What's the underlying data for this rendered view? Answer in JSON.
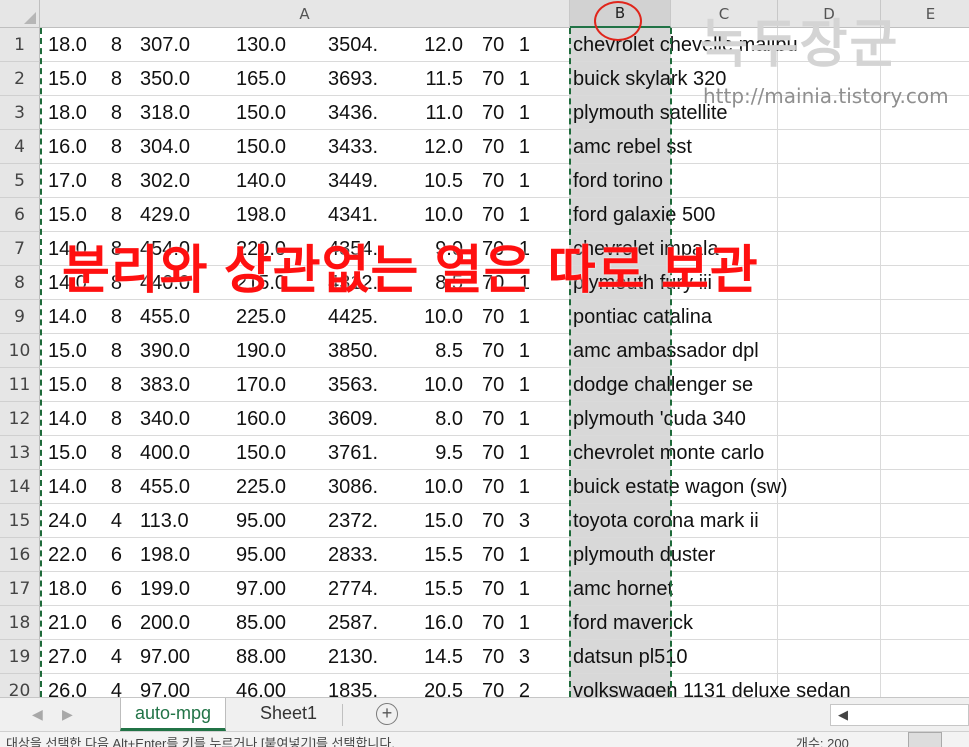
{
  "columns": {
    "A": "A",
    "B": "B",
    "C": "C",
    "D": "D",
    "E": "E"
  },
  "rows": [
    {
      "n": "1",
      "mpg": "18.0",
      "cyl": "8",
      "disp": "307.0",
      "hp": "130.0",
      "wt": "3504.",
      "acc": "12.0",
      "yr": "70",
      "org": "1",
      "name": "chevrolet chevelle malibu"
    },
    {
      "n": "2",
      "mpg": "15.0",
      "cyl": "8",
      "disp": "350.0",
      "hp": "165.0",
      "wt": "3693.",
      "acc": "11.5",
      "yr": "70",
      "org": "1",
      "name": "buick skylark 320"
    },
    {
      "n": "3",
      "mpg": "18.0",
      "cyl": "8",
      "disp": "318.0",
      "hp": "150.0",
      "wt": "3436.",
      "acc": "11.0",
      "yr": "70",
      "org": "1",
      "name": "plymouth satellite"
    },
    {
      "n": "4",
      "mpg": "16.0",
      "cyl": "8",
      "disp": "304.0",
      "hp": "150.0",
      "wt": "3433.",
      "acc": "12.0",
      "yr": "70",
      "org": "1",
      "name": "amc rebel sst"
    },
    {
      "n": "5",
      "mpg": "17.0",
      "cyl": "8",
      "disp": "302.0",
      "hp": "140.0",
      "wt": "3449.",
      "acc": "10.5",
      "yr": "70",
      "org": "1",
      "name": "ford torino"
    },
    {
      "n": "6",
      "mpg": "15.0",
      "cyl": "8",
      "disp": "429.0",
      "hp": "198.0",
      "wt": "4341.",
      "acc": "10.0",
      "yr": "70",
      "org": "1",
      "name": "ford galaxie 500"
    },
    {
      "n": "7",
      "mpg": "14.0",
      "cyl": "8",
      "disp": "454.0",
      "hp": "220.0",
      "wt": "4354.",
      "acc": "9.0",
      "yr": "70",
      "org": "1",
      "name": "chevrolet impala"
    },
    {
      "n": "8",
      "mpg": "14.0",
      "cyl": "8",
      "disp": "440.0",
      "hp": "215.0",
      "wt": "4312.",
      "acc": "8.5",
      "yr": "70",
      "org": "1",
      "name": "plymouth fury iii"
    },
    {
      "n": "9",
      "mpg": "14.0",
      "cyl": "8",
      "disp": "455.0",
      "hp": "225.0",
      "wt": "4425.",
      "acc": "10.0",
      "yr": "70",
      "org": "1",
      "name": "pontiac catalina"
    },
    {
      "n": "10",
      "mpg": "15.0",
      "cyl": "8",
      "disp": "390.0",
      "hp": "190.0",
      "wt": "3850.",
      "acc": "8.5",
      "yr": "70",
      "org": "1",
      "name": "amc ambassador dpl"
    },
    {
      "n": "11",
      "mpg": "15.0",
      "cyl": "8",
      "disp": "383.0",
      "hp": "170.0",
      "wt": "3563.",
      "acc": "10.0",
      "yr": "70",
      "org": "1",
      "name": "dodge challenger se"
    },
    {
      "n": "12",
      "mpg": "14.0",
      "cyl": "8",
      "disp": "340.0",
      "hp": "160.0",
      "wt": "3609.",
      "acc": "8.0",
      "yr": "70",
      "org": "1",
      "name": "plymouth 'cuda 340"
    },
    {
      "n": "13",
      "mpg": "15.0",
      "cyl": "8",
      "disp": "400.0",
      "hp": "150.0",
      "wt": "3761.",
      "acc": "9.5",
      "yr": "70",
      "org": "1",
      "name": "chevrolet monte carlo"
    },
    {
      "n": "14",
      "mpg": "14.0",
      "cyl": "8",
      "disp": "455.0",
      "hp": "225.0",
      "wt": "3086.",
      "acc": "10.0",
      "yr": "70",
      "org": "1",
      "name": "buick estate wagon (sw)"
    },
    {
      "n": "15",
      "mpg": "24.0",
      "cyl": "4",
      "disp": "113.0",
      "hp": "95.00",
      "wt": "2372.",
      "acc": "15.0",
      "yr": "70",
      "org": "3",
      "name": "toyota corona mark ii"
    },
    {
      "n": "16",
      "mpg": "22.0",
      "cyl": "6",
      "disp": "198.0",
      "hp": "95.00",
      "wt": "2833.",
      "acc": "15.5",
      "yr": "70",
      "org": "1",
      "name": "plymouth duster"
    },
    {
      "n": "17",
      "mpg": "18.0",
      "cyl": "6",
      "disp": "199.0",
      "hp": "97.00",
      "wt": "2774.",
      "acc": "15.5",
      "yr": "70",
      "org": "1",
      "name": "amc hornet"
    },
    {
      "n": "18",
      "mpg": "21.0",
      "cyl": "6",
      "disp": "200.0",
      "hp": "85.00",
      "wt": "2587.",
      "acc": "16.0",
      "yr": "70",
      "org": "1",
      "name": "ford maverick"
    },
    {
      "n": "19",
      "mpg": "27.0",
      "cyl": "4",
      "disp": "97.00",
      "hp": "88.00",
      "wt": "2130.",
      "acc": "14.5",
      "yr": "70",
      "org": "3",
      "name": "datsun pl510"
    },
    {
      "n": "20",
      "mpg": "26.0",
      "cyl": "4",
      "disp": "97.00",
      "hp": "46.00",
      "wt": "1835.",
      "acc": "20.5",
      "yr": "70",
      "org": "2",
      "name": "volkswagen 1131 deluxe sedan"
    }
  ],
  "annotation": "분리와 상관없는 열은 따로 보관",
  "watermark": {
    "logo": "녹두장군",
    "url": "http://mainia.tistory.com"
  },
  "sheet_tabs": [
    "auto-mpg",
    "Sheet1"
  ],
  "add_sheet_label": "+",
  "status": {
    "message": "대상을 선택한 다음 Alt+Enter를 키를 누르거나 [붙여넣기]를 선택합니다.",
    "count": "개수: 200"
  },
  "colors": {
    "selection_border": "#1e6b3a",
    "annotation": "#ff1010",
    "circle": "#e0251b",
    "tab_active": "#217346"
  }
}
